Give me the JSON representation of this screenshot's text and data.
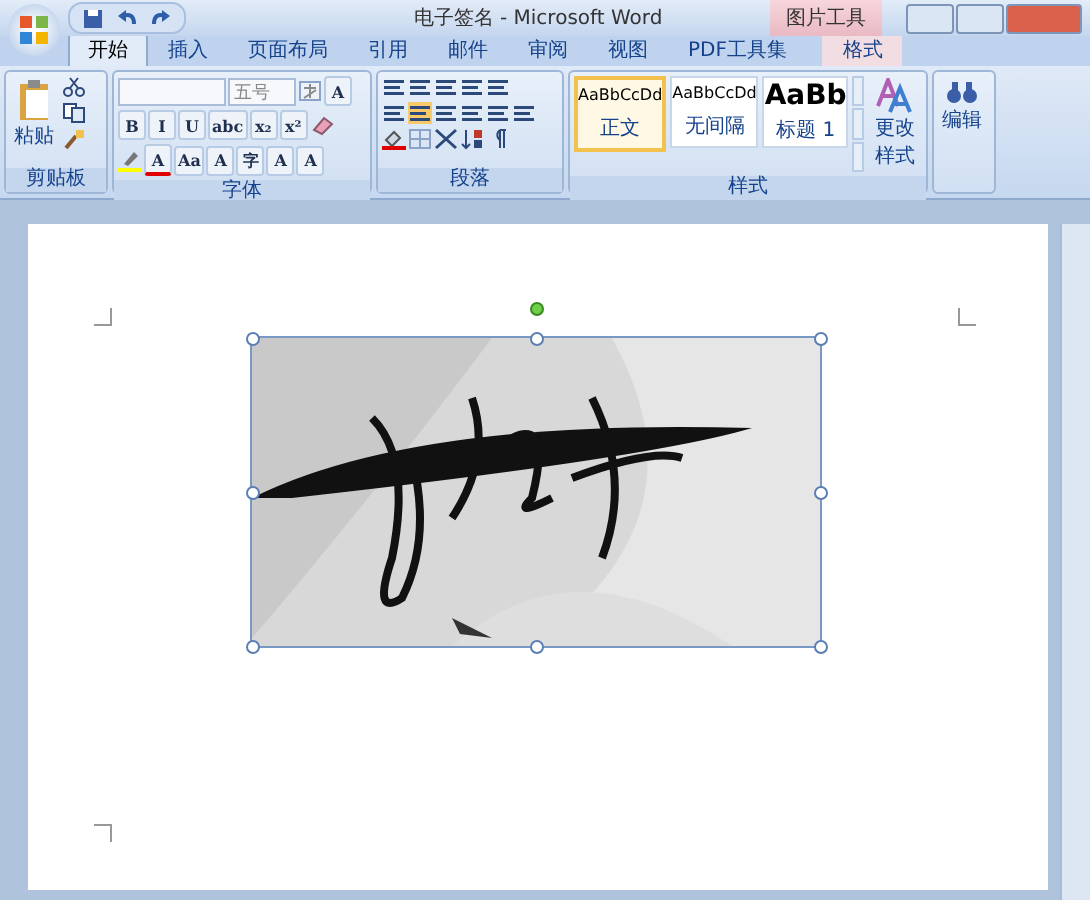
{
  "window": {
    "title": "电子签名 - Microsoft Word",
    "contextual_tab": "图片工具"
  },
  "tabs": [
    {
      "label": "开始",
      "selected": true,
      "kind": "normal"
    },
    {
      "label": "插入",
      "selected": false,
      "kind": "normal"
    },
    {
      "label": "页面布局",
      "selected": false,
      "kind": "normal"
    },
    {
      "label": "引用",
      "selected": false,
      "kind": "normal"
    },
    {
      "label": "邮件",
      "selected": false,
      "kind": "normal"
    },
    {
      "label": "审阅",
      "selected": false,
      "kind": "normal"
    },
    {
      "label": "视图",
      "selected": false,
      "kind": "normal"
    },
    {
      "label": "PDF工具集",
      "selected": false,
      "kind": "normal"
    },
    {
      "label": "格式",
      "selected": false,
      "kind": "contextual"
    }
  ],
  "clipboard": {
    "title": "剪贴板",
    "paste": "粘贴"
  },
  "font": {
    "title": "字体",
    "size": "五号",
    "border_button": "A",
    "format_buttons": [
      "B",
      "I",
      "U",
      "abc",
      "x₂",
      "x²"
    ],
    "effect_buttons": [
      "A",
      "Aa",
      "A",
      "字",
      "A",
      "A"
    ]
  },
  "paragraph": {
    "title": "段落"
  },
  "styles": {
    "title": "样式",
    "change": "更改样式",
    "items": [
      {
        "sample": "AaBbCcDd",
        "name": "正文",
        "selected": true,
        "kind": "body"
      },
      {
        "sample": "AaBbCcDd",
        "name": "无间隔",
        "selected": false,
        "kind": "body"
      },
      {
        "sample": "AaBb",
        "name": "标题 1",
        "selected": false,
        "kind": "heading"
      }
    ]
  },
  "editing": {
    "label": "编辑"
  },
  "document": {
    "picture": {
      "kind": "picture",
      "selected": true
    }
  }
}
